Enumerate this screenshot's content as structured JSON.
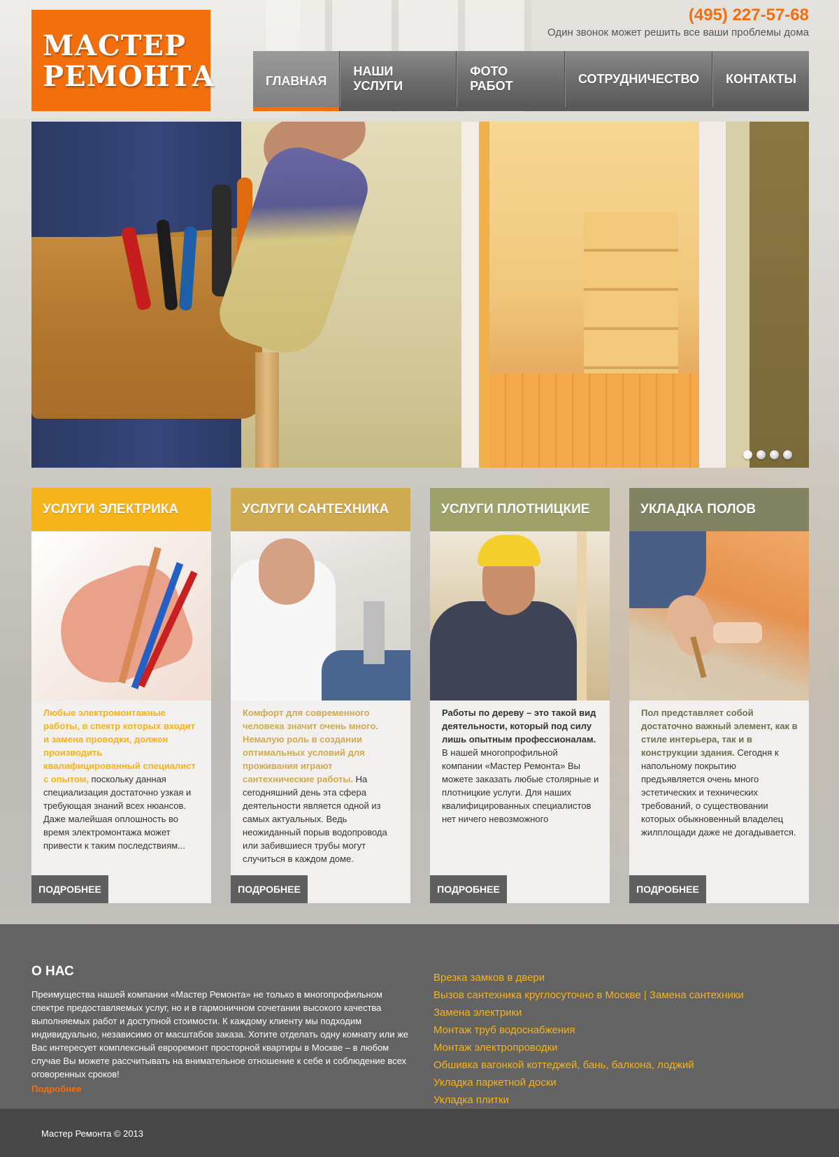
{
  "header": {
    "logo_line1": "МАСТЕР",
    "logo_line2": "РЕМОНТА",
    "phone": "(495) 227-57-68",
    "tagline": "Один звонок может решить все ваши проблемы дома"
  },
  "nav": {
    "items": [
      {
        "label": "ГЛАВНАЯ"
      },
      {
        "label": "НАШИ УСЛУГИ"
      },
      {
        "label": "ФОТО РАБОТ"
      },
      {
        "label": "СОТРУДНИЧЕСТВО"
      },
      {
        "label": "КОНТАКТЫ"
      }
    ],
    "active_index": 0
  },
  "slider": {
    "slide_count": 4,
    "active_slide": 1
  },
  "cards": [
    {
      "title": "УСЛУГИ ЭЛЕКТРИКА",
      "head_color": "#f5b31c",
      "lead_color": "#f5b31c",
      "lead": "Любые электромонтажные работы, в спектр которых входит и замена проводки, должен производить квалифицированный специалист с опытом,",
      "text": "поскольку данная специализация достаточно узкая и требующая знаний всех нюансов. Даже малейшая оплошность во время электромонтажа может привести к таким последствиям...",
      "button": "ПОДРОБНЕЕ"
    },
    {
      "title": "УСЛУГИ САНТЕХНИКА",
      "head_color": "#d0aa50",
      "lead_color": "#d0aa50",
      "lead": "Комфорт для современного человека значит очень много. Немалую роль в создании оптимальных условий для проживания играют сантехнические работы.",
      "text": "На сегодняшний день эта сфера деятельности является одной из самых актуальных. Ведь неожиданный порыв водопровода или забившиеся трубы могут случиться в каждом доме.",
      "button": "ПОДРОБНЕЕ"
    },
    {
      "title": "УСЛУГИ ПЛОТНИЦКИЕ",
      "head_color": "#a0a26c",
      "lead_color": "#333333",
      "lead": "Работы по дереву – это такой вид деятельности, который под силу лишь опытным профессионалам.",
      "text": "В нашей многопрофильной компании «Мастер Ремонта» Вы можете заказать любые столярные и плотницкие услуги. Для наших квалифицированных специалистов нет ничего невозможного",
      "button": "ПОДРОБНЕЕ"
    },
    {
      "title": "УКЛАДКА ПОЛОВ",
      "head_color": "#818363",
      "lead_color": "#6f7150",
      "lead": "Пол представляет собой достаточно важный элемент, как в стиле интерьера, так и в конструкции здания.",
      "text": "Сегодня к напольному покрытию предъявляется очень много эстетических и технических требований, о существовании которых обыкновенный владелец жилплощади даже не догадывается.",
      "button": "ПОДРОБНЕЕ"
    }
  ],
  "about": {
    "title": "О НАС",
    "text": "Преимущества нашей компании «Мастер Ремонта» не только в многопрофильном спектре предоставляемых услуг, но и в гармоничном сочетании высокого качества выполняемых работ и доступной стоимости. К каждому клиенту мы подходим индивидуально, независимо от масштабов заказа. Хотите отделать одну комнату или же Вас интересует комплексный евроремонт просторной квартиры в Москве – в любом случае Вы можете рассчитывать на внимательное отношение к себе и соблюдение всех оговоренных сроков!",
    "more": "Подробнее"
  },
  "links": [
    "Врезка замков в двери",
    "Вызов сантехника круглосуточно в Москве | Замена сантехники",
    "Замена электрики",
    "Монтаж труб водоснабжения",
    "Монтаж электропроводки",
    "Обшивка вагонкой коттеджей, бань, балкона, лоджий",
    "Укладка паркетной доски",
    "Укладка плитки"
  ],
  "footer": {
    "copyright": "Мастер Ремонта © 2013"
  },
  "colors": {
    "accent": "#f36f0d",
    "nav_bg": "#707070",
    "link": "#f5b31c"
  }
}
